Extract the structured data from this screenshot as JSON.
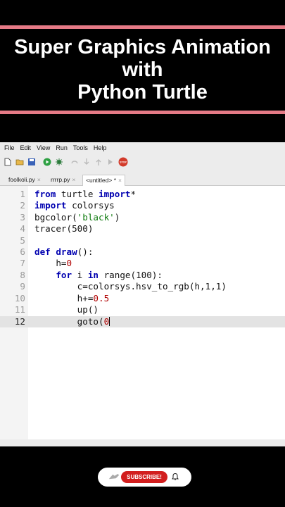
{
  "video": {
    "title_lines": [
      "Super Graphics Animation",
      "with",
      "Python Turtle"
    ],
    "subscribe_label": "SUBSCRIBE!"
  },
  "menu": [
    "File",
    "Edit",
    "View",
    "Run",
    "Tools",
    "Help"
  ],
  "toolbar_icons": [
    "new-file-icon",
    "open-folder-icon",
    "save-icon",
    "run-icon",
    "debug-icon",
    "step-over-icon",
    "step-into-icon",
    "step-out-icon",
    "resume-icon",
    "stop-icon"
  ],
  "tabs": [
    {
      "label": "foolkoli.py",
      "close": "×"
    },
    {
      "label": "rrrrp.py",
      "close": "×"
    },
    {
      "label": "<untitled> *",
      "close": "×"
    }
  ],
  "stop_label": "STOP",
  "code_lines": [
    "from turtle import*",
    "import colorsys",
    "bgcolor('black')",
    "tracer(500)",
    "",
    "def draw():",
    "    h=0",
    "    for i in range(100):",
    "        c=colorsys.hsv_to_rgb(h,1,1)",
    "        h+=0.5",
    "        up()",
    "        goto(0"
  ],
  "line_numbers": [
    "1",
    "2",
    "3",
    "4",
    "5",
    "6",
    "7",
    "8",
    "9",
    "10",
    "11",
    "12"
  ],
  "current_line": "12",
  "colors": {
    "accent_line": "#e57a86",
    "keyword": "#0000b0",
    "string": "#0e7a0e",
    "number": "#b00000",
    "subscribe": "#d21e1e"
  }
}
